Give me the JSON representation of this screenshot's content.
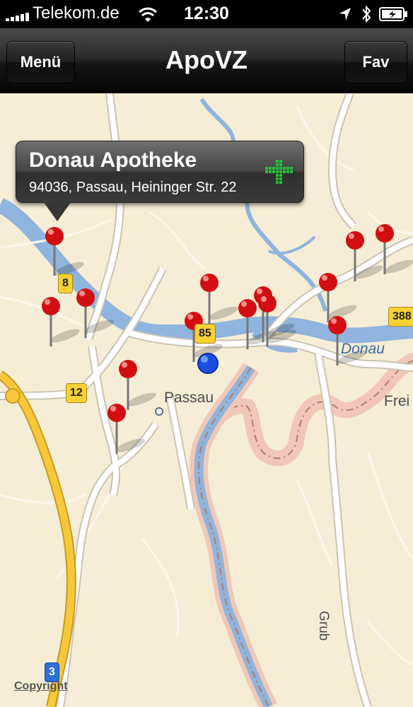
{
  "status": {
    "carrier": "Telekom.de",
    "time": "12:30"
  },
  "nav": {
    "title": "ApoVZ",
    "left_label": "Menü",
    "right_label": "Fav"
  },
  "callout": {
    "name": "Donau Apotheke",
    "address": "94036, Passau, Heininger Str. 22"
  },
  "map": {
    "labels": {
      "city": "Passau",
      "river": "Donau",
      "frey": "Frei",
      "grub": "Grub"
    },
    "shields": {
      "b8": "8",
      "b12": "12",
      "b85": "85",
      "b388": "388",
      "a3": "3"
    },
    "copyright": "Copyright"
  },
  "colors": {
    "pin": "#d10f12",
    "location": "#1c4fe0",
    "water": "#8fb4dd",
    "road": "#ffffff",
    "motorway": "#f7c93a"
  }
}
